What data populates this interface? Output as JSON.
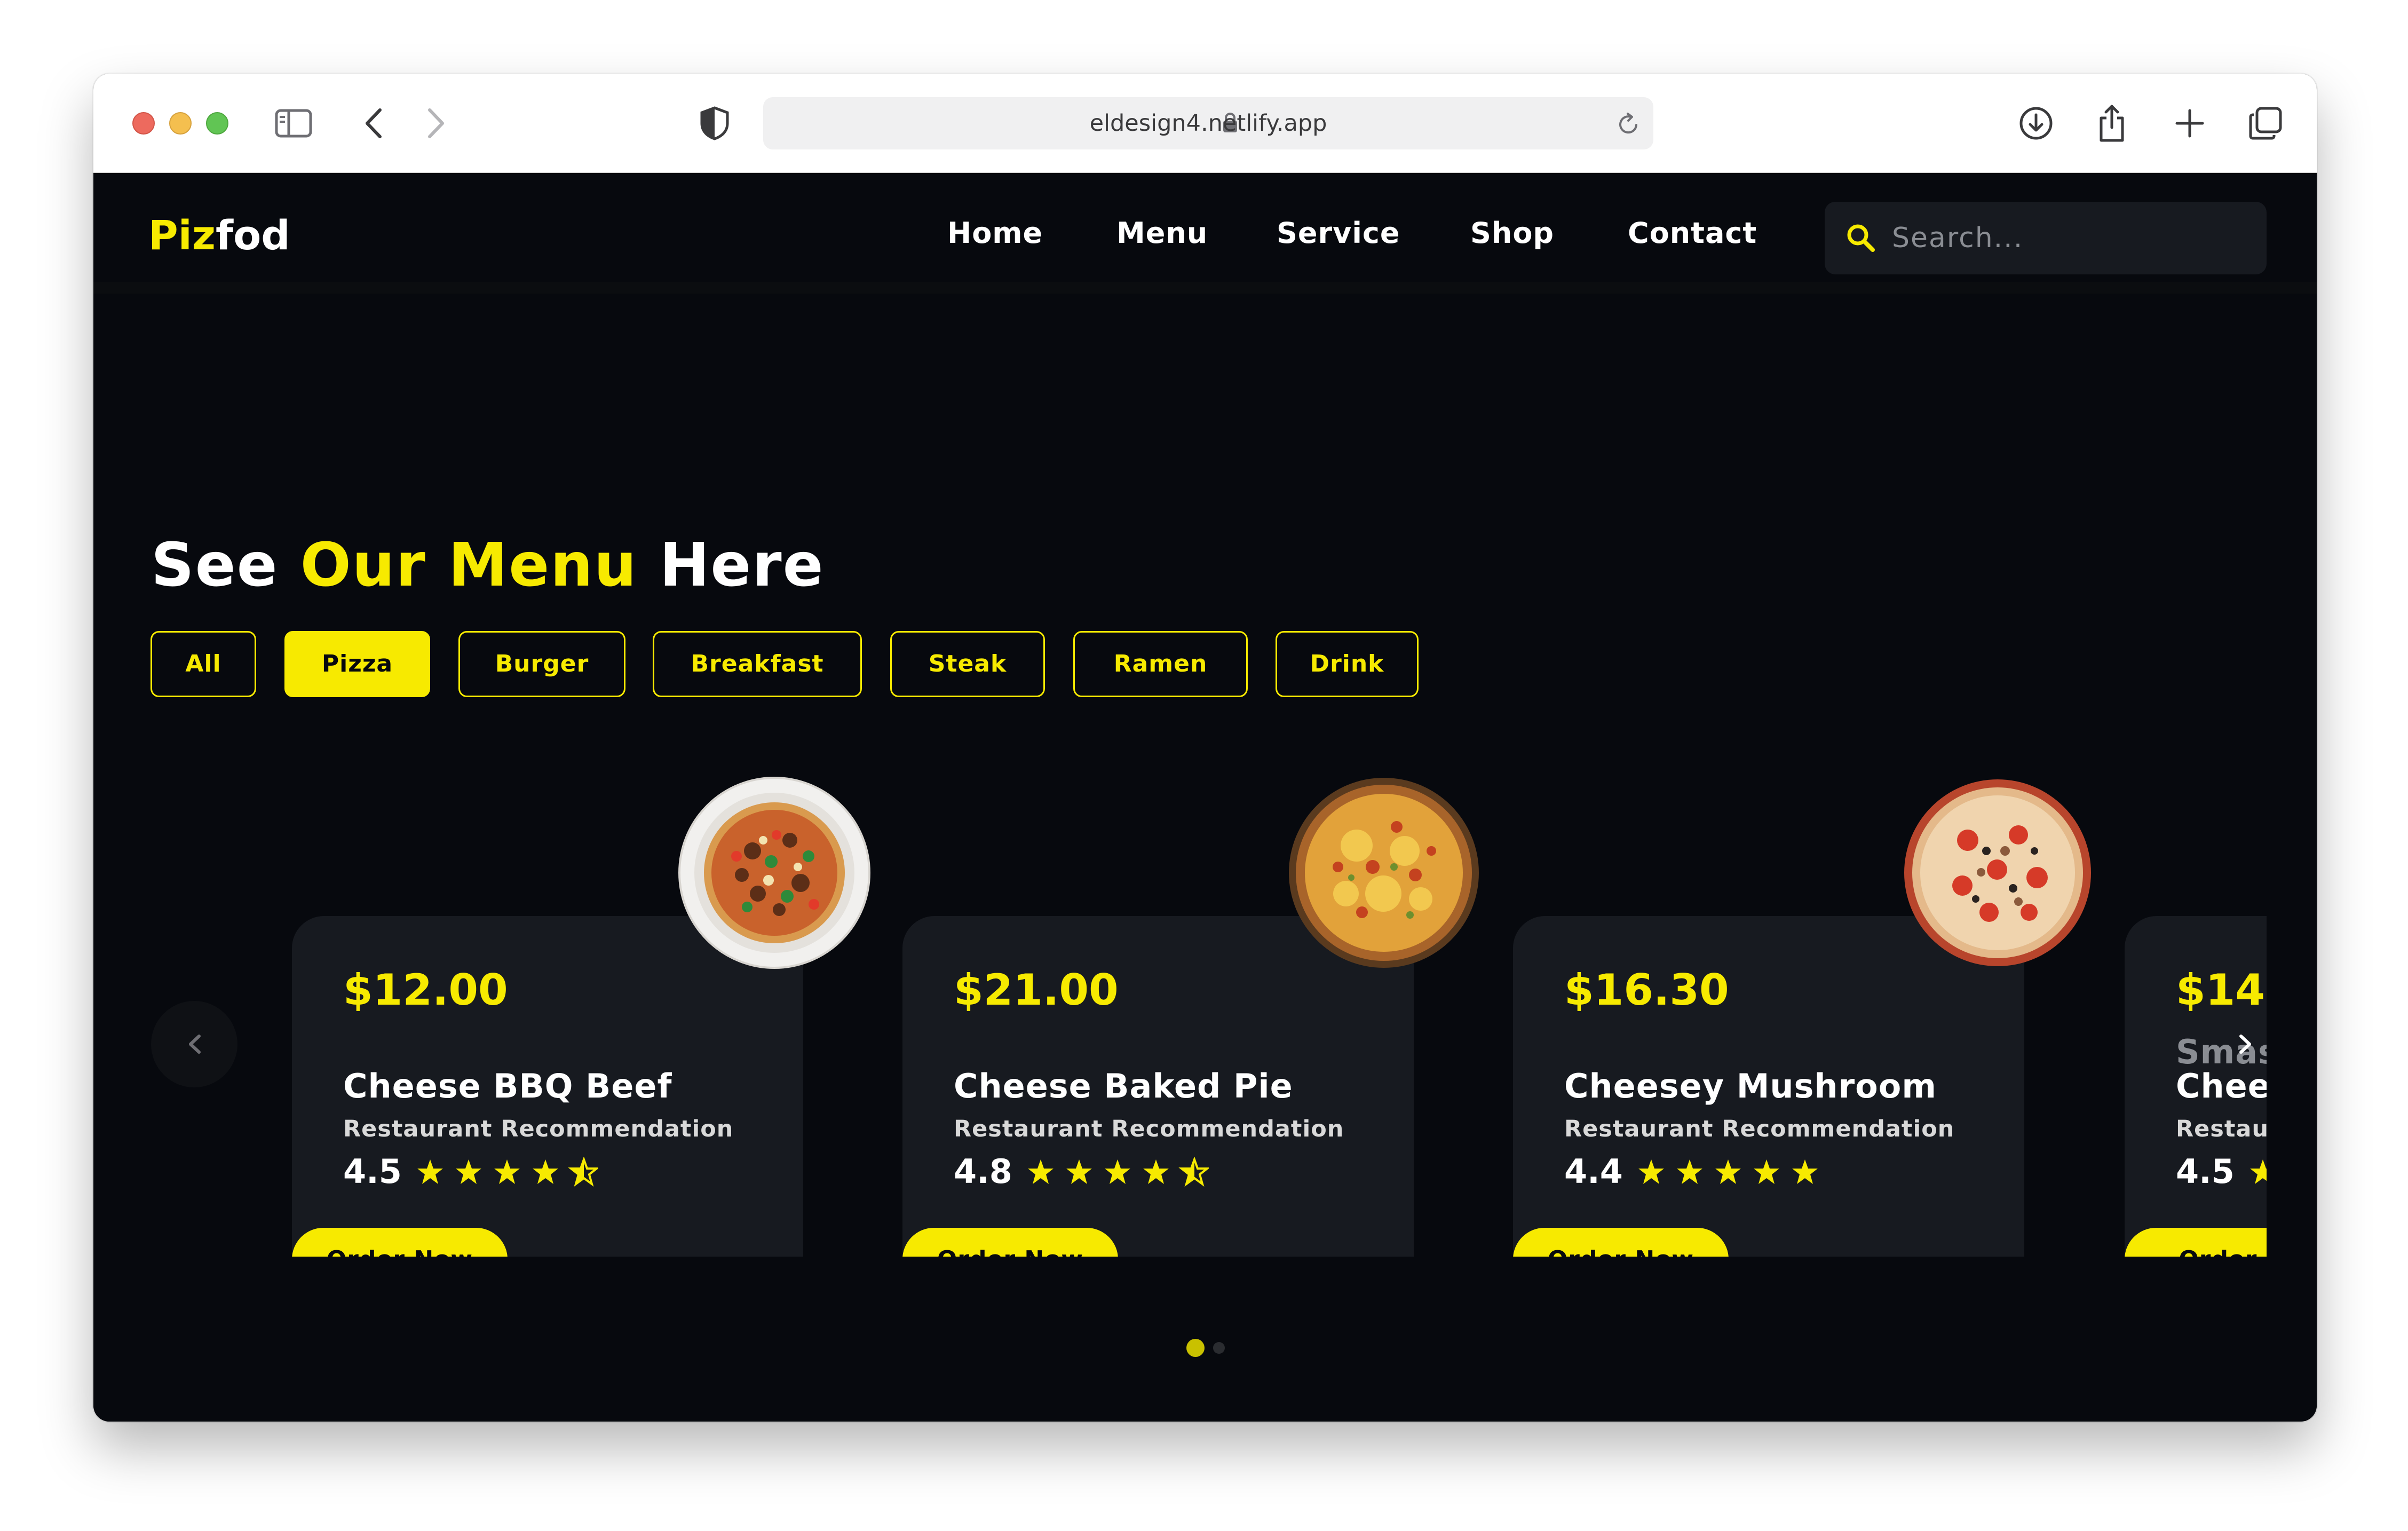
{
  "browser": {
    "url": "eldesign4.netlify.app",
    "icons": [
      "sidebar-icon",
      "back-icon",
      "forward-icon",
      "shield-icon",
      "lock-icon",
      "reload-icon",
      "download-icon",
      "share-icon",
      "new-tab-icon",
      "tabs-icon"
    ]
  },
  "nav": {
    "logo_part1": "Piz",
    "logo_part2": "fod",
    "links": [
      "Home",
      "Menu",
      "Service",
      "Shop",
      "Contact"
    ],
    "search_placeholder": "Search..."
  },
  "menu": {
    "heading_part1": "See ",
    "heading_highlight": "Our Menu",
    "heading_part2": " Here",
    "filters": [
      "All",
      "Pizza",
      "Burger",
      "Breakfast",
      "Steak",
      "Ramen",
      "Drink"
    ],
    "active_filter": "Pizza"
  },
  "cards": [
    {
      "price": "$12.00",
      "name": "Cheese BBQ Beef",
      "subtitle": "Restaurant Recommendation",
      "rating": "4.5",
      "stars": 4.5,
      "button": "Order Now"
    },
    {
      "price": "$21.00",
      "name": "Cheese Baked Pie",
      "subtitle": "Restaurant Recommendation",
      "rating": "4.8",
      "stars": 4.5,
      "button": "Order Now"
    },
    {
      "price": "$16.30",
      "name": "Cheesey Mushroom",
      "subtitle": "Restaurant Recommendation",
      "rating": "4.4",
      "stars": 5,
      "button": "Order Now"
    },
    {
      "price": "$14.",
      "name": "Chee",
      "overlay_text": "Smas",
      "subtitle": "Restau",
      "rating": "4.5",
      "stars": 1,
      "button": "Order N"
    }
  ],
  "carousel": {
    "pages": 2,
    "current_page": 1
  },
  "colors": {
    "accent": "#f7ea00",
    "background": "#07090e",
    "card": "#171a20"
  }
}
